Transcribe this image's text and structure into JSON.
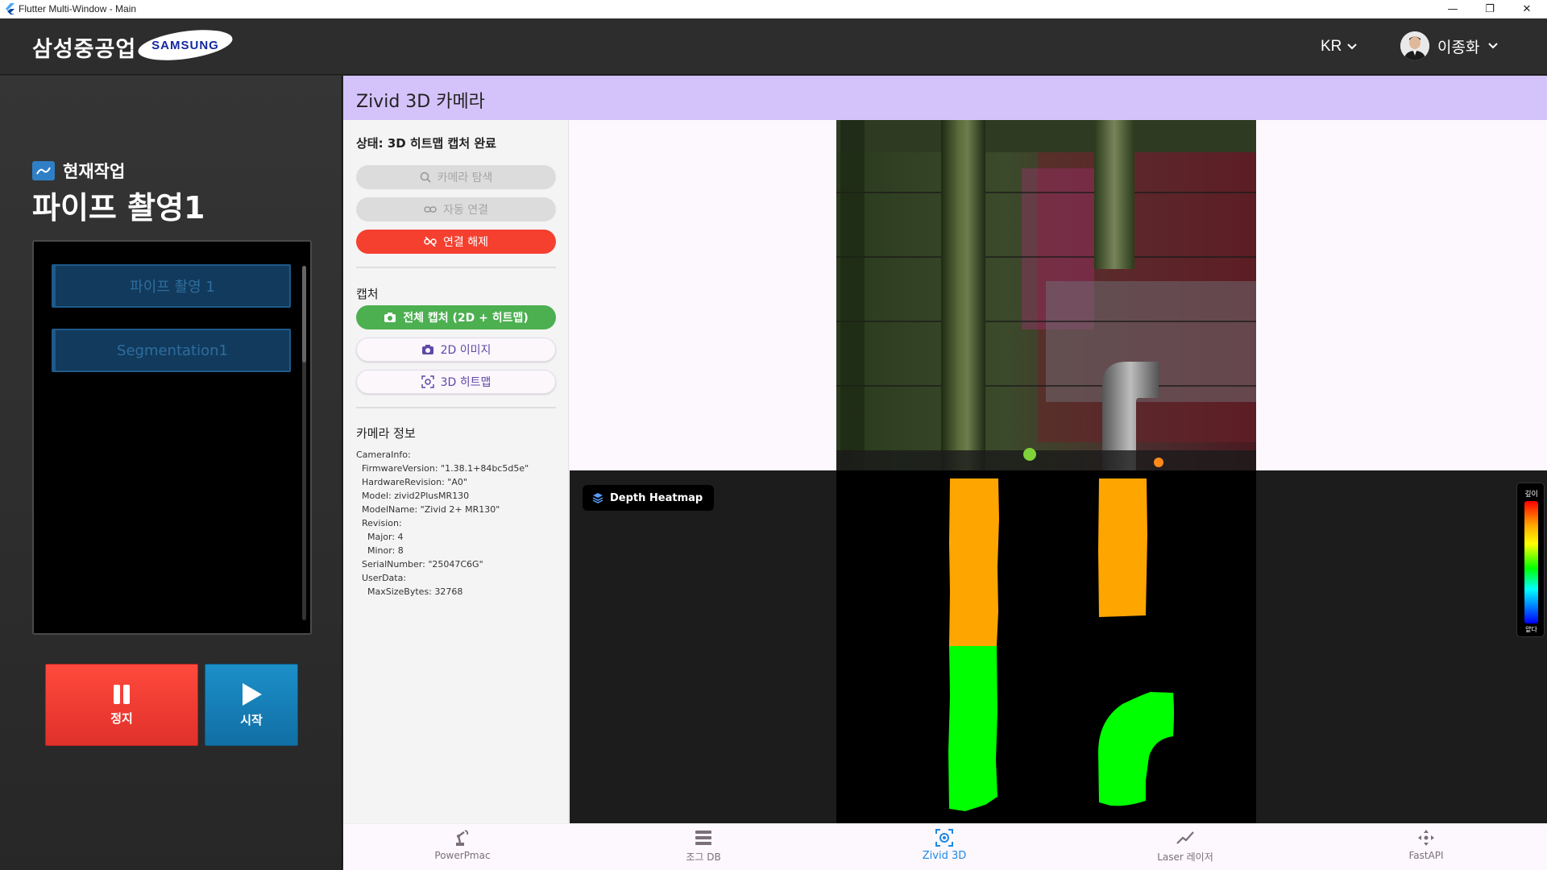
{
  "window": {
    "title": "Flutter Multi-Window - Main",
    "minimize": "—",
    "restore": "❐",
    "close": "✕"
  },
  "header": {
    "brand": "삼성중공업",
    "logo_text": "SAMSUNG",
    "language": "KR",
    "user_name": "이종화"
  },
  "left_panel": {
    "current_task_label": "현재작업",
    "current_task_title": "파이프 촬영1",
    "tasks": [
      {
        "label": "파이프 촬영 1"
      },
      {
        "label": "Segmentation1"
      }
    ],
    "stop_label": "정지",
    "start_label": "시작"
  },
  "page": {
    "title": "Zivid 3D 카메라"
  },
  "controls": {
    "status": "상태: 3D 히트맵 캡처 완료",
    "search_camera": "카메라 탐색",
    "auto_connect": "자동 연결",
    "disconnect": "연결 해제",
    "capture_section": "캡처",
    "full_capture": "전체 캡처 (2D + 히트맵)",
    "image_2d": "2D 이미지",
    "heatmap_3d": "3D 히트맵",
    "camera_info_section": "카메라 정보",
    "camera_info_lines": [
      "CameraInfo:",
      "  FirmwareVersion: \"1.38.1+84bc5d5e\"",
      "  HardwareRevision: \"A0\"",
      "  Model: zivid2PlusMR130",
      "  ModelName: \"Zivid 2+ MR130\"",
      "  Revision:",
      "    Major: 4",
      "    Minor: 8",
      "  SerialNumber: \"25047C6G\"",
      "  UserData:",
      "    MaxSizeBytes: 32768"
    ]
  },
  "viewer": {
    "heatmap_badge": "Depth Heatmap",
    "legend_top": "깊이",
    "legend_bottom": "얕다",
    "colors": {
      "orange": "#ffa500",
      "green": "#00ff00"
    }
  },
  "bottom_nav": {
    "items": [
      {
        "label": "PowerPmac",
        "icon": "robot-arm-icon",
        "active": false
      },
      {
        "label": "조그 DB",
        "icon": "list-icon",
        "active": false
      },
      {
        "label": "Zivid 3D",
        "icon": "camera-scan-icon",
        "active": true
      },
      {
        "label": "Laser 레이저",
        "icon": "trend-line-icon",
        "active": false
      },
      {
        "label": "FastAPI",
        "icon": "move-arrows-icon",
        "active": false
      }
    ],
    "active_color": "#1e88e5"
  }
}
